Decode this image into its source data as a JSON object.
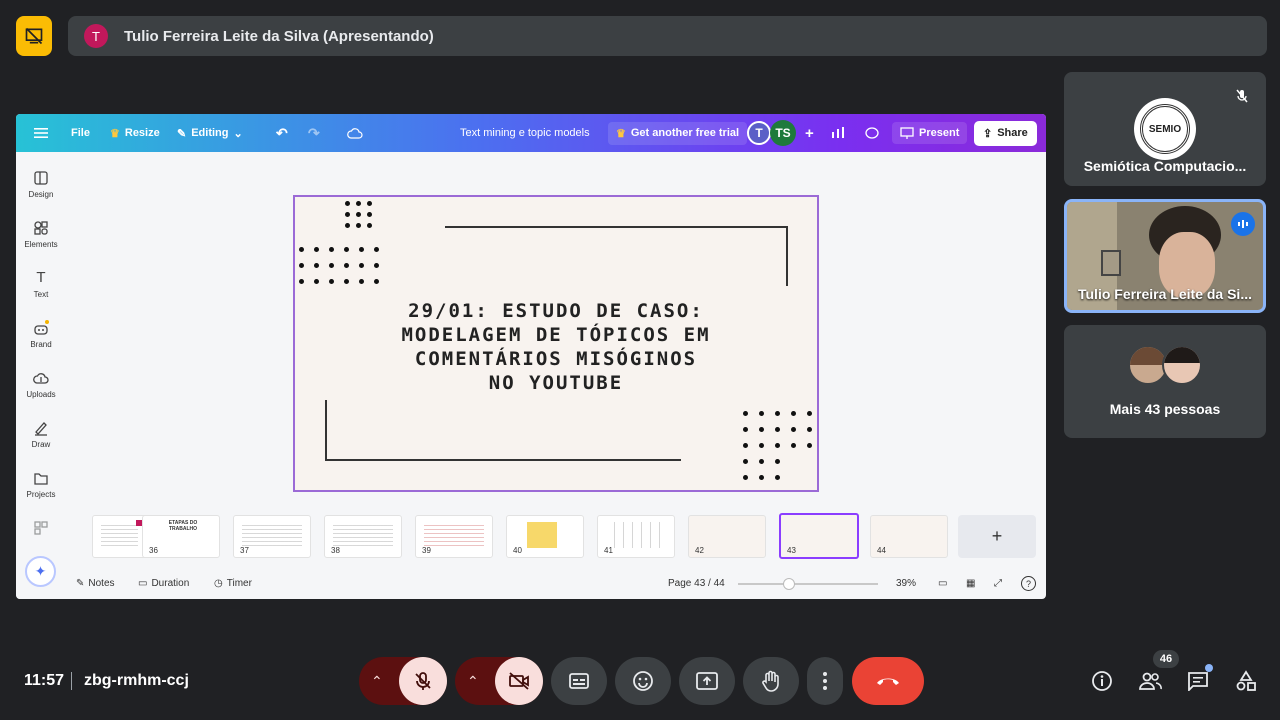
{
  "presenter": {
    "initial": "T",
    "name": "Tulio Ferreira Leite da Silva (Apresentando)"
  },
  "canva": {
    "file_label": "File",
    "resize_label": "Resize",
    "editing_label": "Editing",
    "doc_title": "Text mining e topic models",
    "trial_label": "Get another free trial",
    "avatar_t": "T",
    "avatar_ts": "TS",
    "present_label": "Present",
    "share_label": "Share",
    "side_items": [
      "Design",
      "Elements",
      "Text",
      "Brand",
      "Uploads",
      "Draw",
      "Projects"
    ],
    "slide_title_lines": [
      "29/01: ESTUDO DE CASO:",
      "MODELAGEM DE TÓPICOS EM",
      "COMENTÁRIOS MISÓGINOS",
      "NO YOUTUBE"
    ],
    "thumb_numbers": [
      "36",
      "37",
      "38",
      "39",
      "40",
      "41",
      "42",
      "43",
      "44"
    ],
    "thumb_36_text": "ETAPAS DO TRABALHO",
    "add_page": "+",
    "notes_label": "Notes",
    "duration_label": "Duration",
    "timer_label": "Timer",
    "page_indicator": "Page 43 / 44",
    "zoom": "39%"
  },
  "participants": {
    "tile1_name": "Semiótica Computacio...",
    "logo_text": "SEMIO",
    "tile2_name": "Tulio Ferreira Leite da Si...",
    "tile3_name": "Mais 43 pessoas"
  },
  "bottom_bar": {
    "time": "11:57",
    "meeting_code": "zbg-rmhm-ccj",
    "people_count": "46"
  },
  "colors": {
    "accent_yellow": "#fbbc04",
    "end_call_red": "#ea4335",
    "active_blue": "#8ab4f8"
  }
}
